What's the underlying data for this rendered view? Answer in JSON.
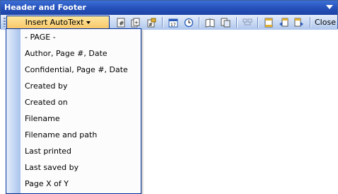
{
  "window": {
    "title": "Header and Footer"
  },
  "toolbar": {
    "insert_autotext_label": "Insert AutoText",
    "insert_autotext_accesskey": "A",
    "close_label": "Close",
    "icons": [
      "insert-page-number-icon",
      "insert-number-of-pages-icon",
      "format-page-number-icon",
      "insert-date-icon",
      "insert-time-icon",
      "page-setup-icon",
      "show-hide-document-text-icon",
      "same-as-previous-icon",
      "switch-header-footer-icon",
      "show-previous-icon",
      "show-next-icon"
    ]
  },
  "menu": {
    "items": [
      {
        "label": "- PAGE -"
      },
      {
        "label": "Author, Page #, Date"
      },
      {
        "label": "Confidential, Page #, Date"
      },
      {
        "label": "Created by"
      },
      {
        "label": "Created on"
      },
      {
        "label": "Filename"
      },
      {
        "label": "Filename and path"
      },
      {
        "label": "Last printed"
      },
      {
        "label": "Last saved by"
      },
      {
        "label": "Page X of Y"
      }
    ]
  },
  "colors": {
    "title_bar": "#2450b8",
    "toolbar": "#c5d7f2",
    "highlight": "#f8c86b",
    "menu_border": "#002d96"
  }
}
